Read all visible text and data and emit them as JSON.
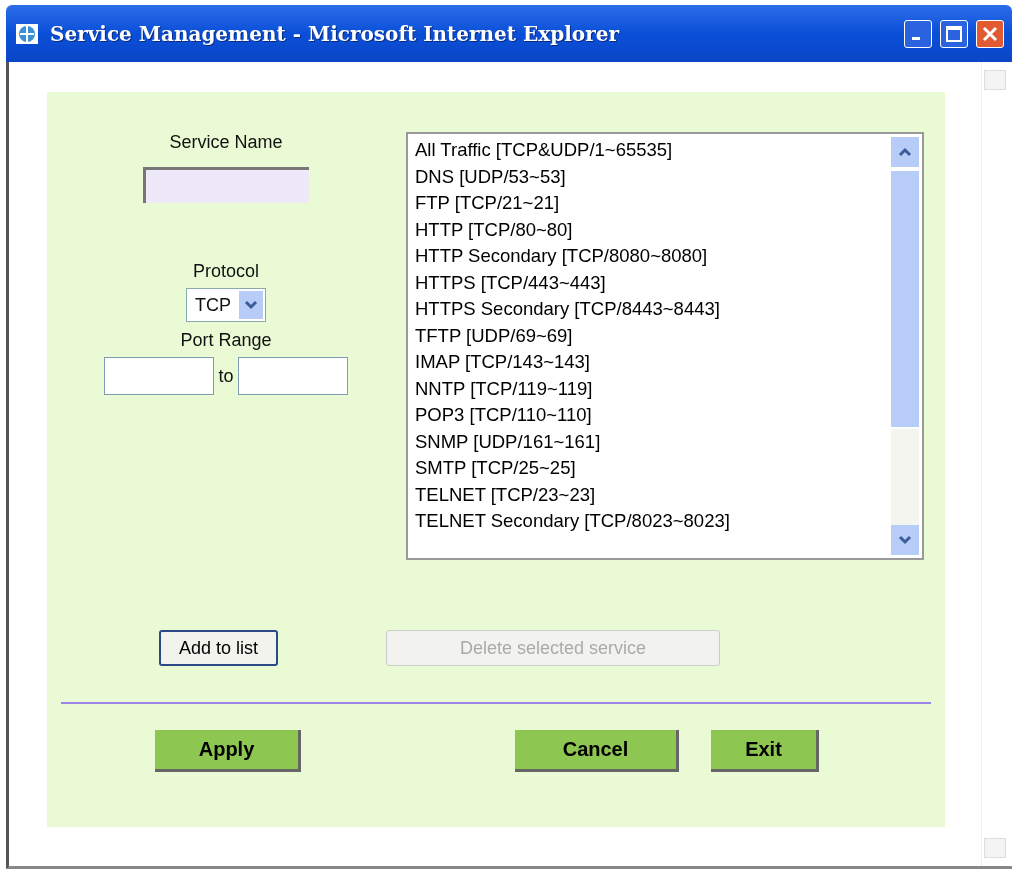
{
  "window": {
    "title": "Service Management - Microsoft Internet Explorer"
  },
  "form": {
    "service_name_label": "Service Name",
    "protocol_label": "Protocol",
    "protocol_value": "TCP",
    "port_range_label": "Port Range",
    "port_to": "to"
  },
  "services": [
    {
      "label": "All Traffic [TCP&UDP/1~65535]",
      "selected": false
    },
    {
      "label": "DNS [UDP/53~53]",
      "selected": false
    },
    {
      "label": "FTP [TCP/21~21]",
      "selected": false
    },
    {
      "label": "HTTP [TCP/80~80]",
      "selected": false
    },
    {
      "label": "HTTP Secondary [TCP/8080~8080]",
      "selected": false
    },
    {
      "label": "HTTPS [TCP/443~443]",
      "selected": false
    },
    {
      "label": "HTTPS Secondary [TCP/8443~8443]",
      "selected": false
    },
    {
      "label": "TFTP [UDP/69~69]",
      "selected": false
    },
    {
      "label": "IMAP [TCP/143~143]",
      "selected": false
    },
    {
      "label": "NNTP [TCP/119~119]",
      "selected": false
    },
    {
      "label": "POP3 [TCP/110~110]",
      "selected": false
    },
    {
      "label": "SNMP [UDP/161~161]",
      "selected": false
    },
    {
      "label": "SMTP [TCP/25~25]",
      "selected": false
    },
    {
      "label": "TELNET [TCP/23~23]",
      "selected": false
    },
    {
      "label": "TELNET Secondary [TCP/8023~8023]",
      "selected": false
    }
  ],
  "list_buttons": [
    {
      "label": "Add to list",
      "disabled": false
    },
    {
      "label": "Delete selected service",
      "disabled": true
    }
  ],
  "action_buttons": [
    "Apply",
    "Cancel",
    "Exit"
  ]
}
